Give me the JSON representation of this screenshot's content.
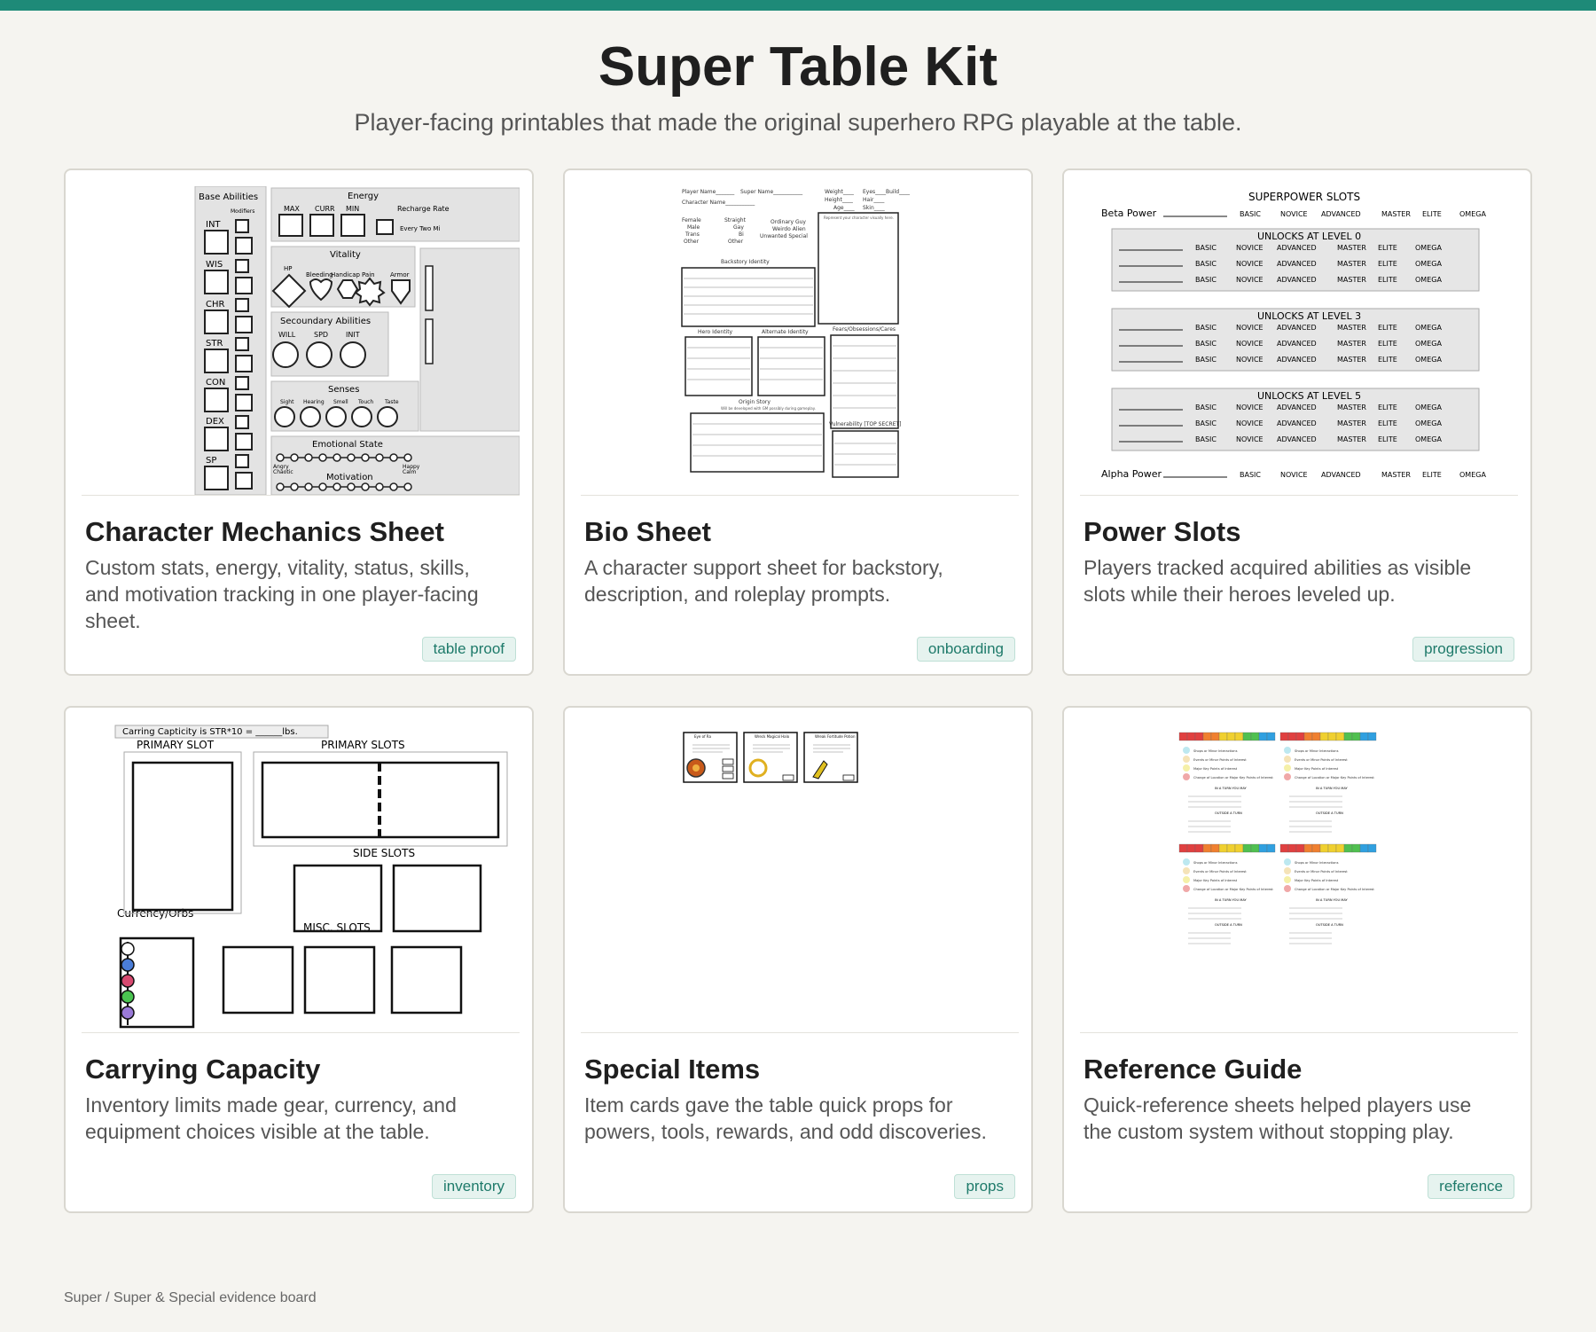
{
  "header": {
    "title": "Super Table Kit",
    "subtitle": "Player-facing printables that made the original superhero RPG playable at the table."
  },
  "cards": [
    {
      "title": "Character Mechanics Sheet",
      "description": "Custom stats, energy, vitality, status, skills, and motivation tracking in one player-facing sheet.",
      "tag": "table proof"
    },
    {
      "title": "Bio Sheet",
      "description": "A character support sheet for backstory, description, and roleplay prompts.",
      "tag": "onboarding"
    },
    {
      "title": "Power Slots",
      "description": "Players tracked acquired abilities as visible slots while their heroes leveled up.",
      "tag": "progression"
    },
    {
      "title": "Carrying Capacity",
      "description": "Inventory limits made gear, currency, and equipment choices visible at the table.",
      "tag": "inventory"
    },
    {
      "title": "Special Items",
      "description": "Item cards gave the table quick props for powers, tools, rewards, and odd discoveries.",
      "tag": "props"
    },
    {
      "title": "Reference Guide",
      "description": "Quick-reference sheets helped players use the custom system without stopping play.",
      "tag": "reference"
    }
  ],
  "thumbs": {
    "mechanics": {
      "base_abilities": "Base Abilities",
      "modifiers": "Modifiers",
      "stats": [
        "INT",
        "WIS",
        "CHR",
        "STR",
        "CON",
        "DEX",
        "SP"
      ],
      "energy": "Energy",
      "max": "MAX",
      "curr": "CURR",
      "min": "MIN",
      "recharge": "Recharge Rate",
      "every": "Every Two Mi",
      "vitality": "Vitality",
      "hp": "HP",
      "bleeding": "Bleeding",
      "handicap": "Handicap",
      "pain": "Pain",
      "armor": "Armor",
      "secondary": "Secoundary Abilities",
      "will": "WILL",
      "spd": "SPD",
      "init": "INIT",
      "senses": "Senses",
      "sense_names": [
        "Sight",
        "Hearing",
        "Smell",
        "Touch",
        "Taste"
      ],
      "emotional": "Emotional State",
      "angry": "Angry",
      "chaotic": "Chaotic",
      "happy": "Happy",
      "calm": "Calm",
      "motivation": "Motivation"
    },
    "bio": {
      "player_name": "Player Name_______",
      "super_name": "Super Name___________",
      "character_name": "Character Name___________",
      "weight": "Weight____",
      "height": "Height____",
      "age": "Age____",
      "eyes": "Eyes____",
      "hair": "Hair____",
      "skin": "Skin____",
      "build": "Build____",
      "female": "Female",
      "male": "Male",
      "trans": "Trans",
      "other": "Other",
      "straight": "Straight",
      "gay": "Gay",
      "bi": "Bi",
      "other2": "Other",
      "ordinary": "Ordinary Guy",
      "weirdo": "Weirdo Alien",
      "unwanted": "Unwanted Special",
      "represent": "Represent your character visually here.",
      "backstory": "Backstory Identity",
      "hero": "Hero Identity",
      "alternate": "Alternate Identity",
      "fears": "Fears/Obsessions/Cares",
      "origin": "Origin Story",
      "origin_note": "Will be developed with GM possibly during gameplay.",
      "vulnerability": "Vulnerability [TOP SECRET]"
    },
    "power": {
      "heading": "SUPERPOWER SLOTS",
      "beta": "Beta Power",
      "alpha": "Alpha Power",
      "tiers": [
        "BASIC",
        "NOVICE",
        "ADVANCED",
        "MASTER",
        "ELITE",
        "OMEGA"
      ],
      "level0": "UNLOCKS AT LEVEL 0",
      "level3": "UNLOCKS AT LEVEL 3",
      "level5": "UNLOCKS AT LEVEL 5"
    },
    "carry": {
      "capacity": "Carring Capticity is STR*10 = ______lbs.",
      "primary_slot": "PRIMARY SLOT",
      "primary_slots": "PRIMARY SLOTS",
      "side_slots": "SIDE SLOTS",
      "currency": "Currency/Orbs",
      "misc": "MISC. SLOTS"
    },
    "items": {
      "card1": "Eye of Ra",
      "card2": "Wreck Magical Halo",
      "card3": "Wreak Fortitude Potion"
    },
    "reference": {
      "rows": [
        "Shops or Minor Interactions",
        "Events or Minor Points of Interest",
        "Major Key Points of Interest",
        "Change of Location or Major Key Points of Interest"
      ],
      "in_turn": "IN A TURN YOU MAY",
      "outside": "OUTSIDE A TURN"
    }
  },
  "colors": {
    "accent": "#1e8a78",
    "tag_bg": "#e6f3ef"
  },
  "footer": "Super / Super & Special evidence board"
}
